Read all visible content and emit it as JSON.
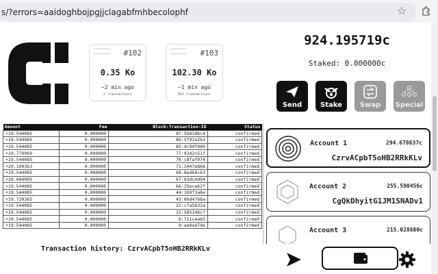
{
  "browser": {
    "url": "s/?errors=aaidoghbojpgjjclagabfmhbecolophf"
  },
  "blocks": [
    {
      "number": "#102",
      "value": "0.35 Ko",
      "ago": "~2 min ago",
      "tx_count": "2 transactions"
    },
    {
      "number": "#103",
      "value": "102.30 Ko",
      "ago": "~1 min ago",
      "tx_count": "462 transactions"
    }
  ],
  "wallet": {
    "balance": "924.195719c",
    "staked": "Staked: 0.000000c"
  },
  "actions": [
    {
      "label": "Send",
      "icon": "paper-plane-icon",
      "enabled": true
    },
    {
      "label": "Stake",
      "icon": "seedling-icon",
      "enabled": true
    },
    {
      "label": "Swap",
      "icon": "swap-arrows-icon",
      "enabled": false
    },
    {
      "label": "Special",
      "icon": "network-icon",
      "enabled": false
    }
  ],
  "table": {
    "headers": [
      "Amount",
      "Fee",
      "Block:Transaction-ID",
      "Status"
    ],
    "rows": [
      [
        "+19.544085",
        "0.000000",
        "87:5b83d6c4",
        "confirmed"
      ],
      [
        "+19.544085",
        "0.000000",
        "86:5f92a2b3",
        "confirmed"
      ],
      [
        "+19.544085",
        "0.000000",
        "85:dc9df480",
        "confirmed"
      ],
      [
        "+19.779969",
        "0.000000",
        "77:9242c51f",
        "confirmed"
      ],
      [
        "+19.544085",
        "0.000000",
        "76:c8faf074",
        "confirmed"
      ],
      [
        "+20.109363",
        "0.000000",
        "71:2447e866",
        "confirmed"
      ],
      [
        "+19.544085",
        "0.000000",
        "68:8ed68c63",
        "confirmed"
      ],
      [
        "+20.084005",
        "0.000000",
        "67:83dc4d94",
        "confirmed"
      ],
      [
        "+19.544085",
        "0.000000",
        "66:25ece62f",
        "confirmed"
      ],
      [
        "+19.544085",
        "0.000000",
        "44:1b9f3a6e",
        "confirmed"
      ],
      [
        "+19.720365",
        "0.000000",
        "43:0bd4768a",
        "confirmed"
      ],
      [
        "+19.544085",
        "0.000000",
        "22:cfa5b32a",
        "confirmed"
      ],
      [
        "+19.544085",
        "0.000000",
        "15:58514bcf",
        "confirmed"
      ],
      [
        "+19.544085",
        "0.000000",
        "6:711c4ab5",
        "confirmed"
      ],
      [
        "+19.544085",
        "0.000000",
        "0:ae8a47de",
        "confirmed"
      ]
    ]
  },
  "history_label": "Transaction history: CzrvACpbT5oHB2RRkKLv",
  "accounts": [
    {
      "name": "Account 1",
      "balance": "294.678637c",
      "address": "CzrvACpbT5oHB2RRkKLv",
      "selected": true
    },
    {
      "name": "Account 2",
      "balance": "255.590456c",
      "address": "CgQkDhyitG1JM1SNADv1",
      "selected": false
    },
    {
      "name": "Account 3",
      "balance": "215.028680c",
      "address": "",
      "selected": false
    }
  ],
  "nav": [
    "send-icon",
    "wallet-icon",
    "settings-icon"
  ]
}
